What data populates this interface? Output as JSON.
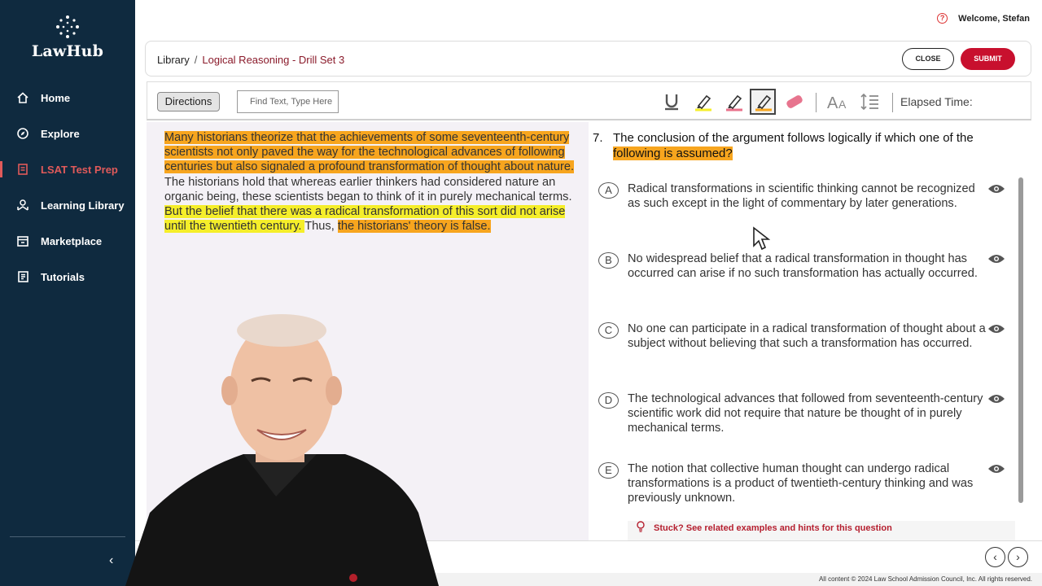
{
  "app": {
    "logo_text": "LawHub"
  },
  "sidebar": {
    "items": [
      {
        "label": "Home",
        "icon": "home-icon"
      },
      {
        "label": "Explore",
        "icon": "explore-icon"
      },
      {
        "label": "LSAT Test Prep",
        "icon": "test-prep-icon",
        "active": true
      },
      {
        "label": "Learning Library",
        "icon": "learning-library-icon"
      },
      {
        "label": "Marketplace",
        "icon": "marketplace-icon"
      },
      {
        "label": "Tutorials",
        "icon": "tutorials-icon"
      }
    ],
    "collapse_glyph": "‹"
  },
  "header": {
    "help_glyph": "?",
    "welcome": "Welcome, Stefan"
  },
  "breadcrumb": {
    "library": "Library",
    "separator": "/",
    "current": "Logical Reasoning - Drill Set 3",
    "close_label": "CLOSE",
    "submit_label": "SUBMIT"
  },
  "toolbar": {
    "directions_label": "Directions",
    "find_placeholder": "Find Text, Type Here",
    "elapsed_label": "Elapsed Time:",
    "tools": [
      "underline-tool",
      "yellow-highlighter",
      "pink-highlighter",
      "orange-highlighter",
      "eraser",
      "font-size-tool",
      "line-spacing-tool"
    ],
    "colors": {
      "yellow": "#f5ee2a",
      "orange": "#f7a51e",
      "pink": "#e8708a",
      "accent_red": "#c8102e"
    }
  },
  "passage": {
    "segments": [
      {
        "text": "Many historians theorize that the achievements of some seventeenth-century scientists not only paved the way for the technological advances of following centuries but also signaled a profound transformation of thought about nature. ",
        "highlight": "orange"
      },
      {
        "text": "The historians hold that whereas earlier thinkers had considered nature an organic being, these scientists began to think of it in purely mechanical terms. ",
        "highlight": "none"
      },
      {
        "text": "But the belief that there was a radical transformation of this sort did not arise until the twentieth century. ",
        "highlight": "yellow"
      },
      {
        "text": "Thus, ",
        "highlight": "none"
      },
      {
        "text": "the historians' theory is false. ",
        "highlight": "orange"
      }
    ]
  },
  "question": {
    "number": "7.",
    "stem_part1": "The conclusion of the argument follows logically if which one of the ",
    "stem_part2": "following is assumed?",
    "choices": [
      {
        "letter": "A",
        "text": "Radical transformations in scientific thinking cannot be recognized as such except in the light of commentary by later generations."
      },
      {
        "letter": "B",
        "text": "No widespread belief that a radical transformation in thought has occurred can arise if no such transformation has actually occurred."
      },
      {
        "letter": "C",
        "text": "No one can participate in a radical transformation of thought about a subject without believing that such a transformation has occurred."
      },
      {
        "letter": "D",
        "text": "The technological advances that followed from seventeenth-century scientific work did not require that nature be thought of in purely mechanical terms."
      },
      {
        "letter": "E",
        "text": "The notion that collective human thought can undergo radical transformations is a product of twentieth-century thinking and was previously unknown."
      }
    ],
    "stuck_text": "Stuck? See related examples and hints for this question"
  },
  "navigation": {
    "prev_glyph": "‹",
    "next_glyph": "›"
  },
  "footer": {
    "text": "All content © 2024 Law School Admission Council, Inc. All rights reserved."
  }
}
